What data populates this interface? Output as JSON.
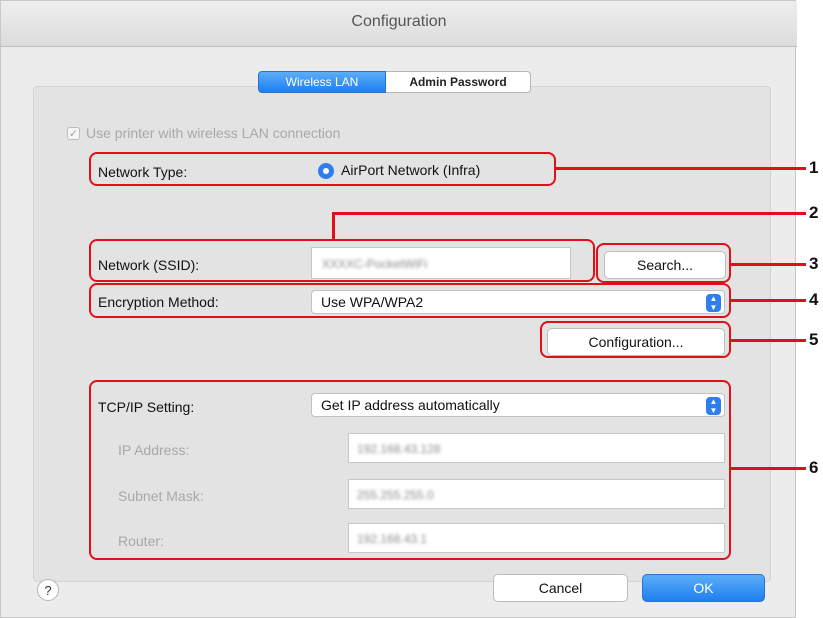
{
  "window": {
    "title": "Configuration"
  },
  "tabs": [
    {
      "label": "Wireless LAN",
      "selected": true
    },
    {
      "label": "Admin Password",
      "selected": false
    }
  ],
  "use_wireless": {
    "label": "Use printer with wireless LAN connection",
    "checked": true,
    "enabled": false
  },
  "network_type": {
    "label": "Network Type:",
    "option": "AirPort Network (Infra)",
    "selected": true
  },
  "ssid": {
    "label": "Network (SSID):",
    "value": "XXXXC-PocketWiFi",
    "search_button": "Search..."
  },
  "encryption": {
    "label": "Encryption Method:",
    "value": "Use WPA/WPA2"
  },
  "configuration_button": "Configuration...",
  "tcpip": {
    "label": "TCP/IP Setting:",
    "value": "Get IP address automatically",
    "ip_label": "IP Address:",
    "ip_value": "192.168.43.128",
    "subnet_label": "Subnet Mask:",
    "subnet_value": "255.255.255.0",
    "router_label": "Router:",
    "router_value": "192.168.43.1"
  },
  "buttons": {
    "help": "?",
    "cancel": "Cancel",
    "ok": "OK"
  },
  "callouts": [
    "1",
    "2",
    "3",
    "4",
    "5",
    "6"
  ],
  "colors": {
    "accent": "#1f7ef0",
    "highlight": "#e0101a"
  }
}
